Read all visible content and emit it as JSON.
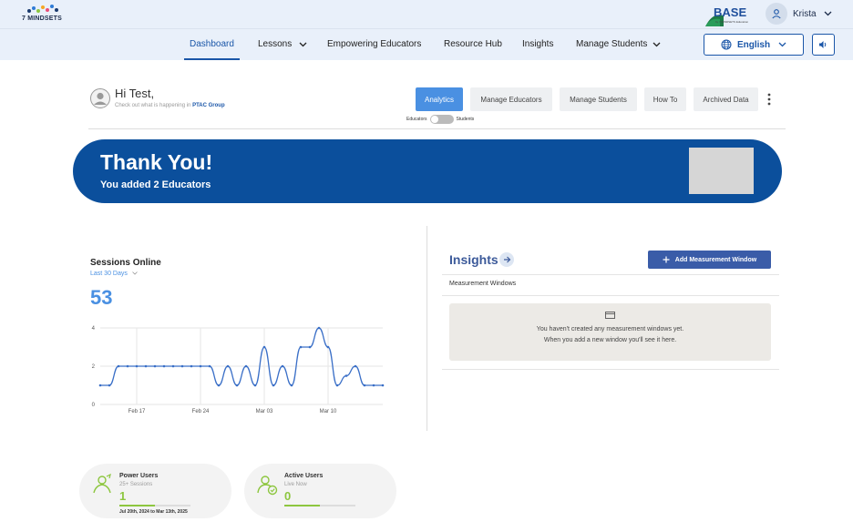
{
  "brand": {
    "name": "7 MINDSETS",
    "product": "BASE",
    "product_sub": "by 7 MINDSETS Education"
  },
  "user": {
    "name": "Krista"
  },
  "nav": {
    "items": [
      {
        "label": "Dashboard",
        "active": true
      },
      {
        "label": "Lessons",
        "dropdown": true
      },
      {
        "label": "Empowering Educators"
      },
      {
        "label": "Resource Hub"
      },
      {
        "label": "Insights"
      },
      {
        "label": "Manage Students",
        "dropdown": true
      }
    ],
    "language": "English"
  },
  "greeting": {
    "title": "Hi Test,",
    "subtitle": "Check out what is happening in",
    "group": "PTAC Group"
  },
  "tabs": [
    "Analytics",
    "Manage Educators",
    "Manage Students",
    "How To",
    "Archived Data"
  ],
  "toggle": {
    "left": "Educators",
    "right": "Students"
  },
  "banner": {
    "title": "Thank You!",
    "subtitle": "You added 2 Educators"
  },
  "sessions": {
    "title": "Sessions Online",
    "period": "Last 30 Days",
    "value": "53"
  },
  "chart_data": {
    "type": "line",
    "title": "",
    "xlabel": "",
    "ylabel": "",
    "ylim": [
      0,
      4
    ],
    "y_ticks": [
      "0",
      "2",
      "4"
    ],
    "x_ticks": [
      "Feb 17",
      "Feb 24",
      "Mar 03",
      "Mar 10"
    ],
    "series": [
      {
        "values": [
          1,
          1,
          2,
          2,
          2,
          2,
          2,
          2,
          2,
          2,
          2,
          2,
          2,
          1,
          2,
          1,
          2,
          1,
          3,
          1,
          2,
          1,
          3,
          3,
          4,
          3,
          1,
          1.5,
          2,
          1,
          1,
          1
        ]
      }
    ]
  },
  "insights": {
    "title": "Insights",
    "add_button": "Add Measurement Window",
    "section_label": "Measurement Windows",
    "empty_line1": "You haven't created any measurement windows yet.",
    "empty_line2": "When you add a new window you'll see it here."
  },
  "stats": [
    {
      "title": "Power Users",
      "sub": "25+ Sessions",
      "value": "1",
      "bar_fraction": 0.5,
      "date": "Jul 20th, 2024 to Mar 13th, 2025",
      "color": "#8dc63f"
    },
    {
      "title": "Active Users",
      "sub": "Live Now",
      "value": "0",
      "bar_fraction": 0.5,
      "color": "#8dc63f"
    }
  ],
  "colors": {
    "primary": "#1a56a8",
    "banner": "#0b4f9c",
    "accent": "#4a90e2",
    "green": "#8dc63f"
  }
}
